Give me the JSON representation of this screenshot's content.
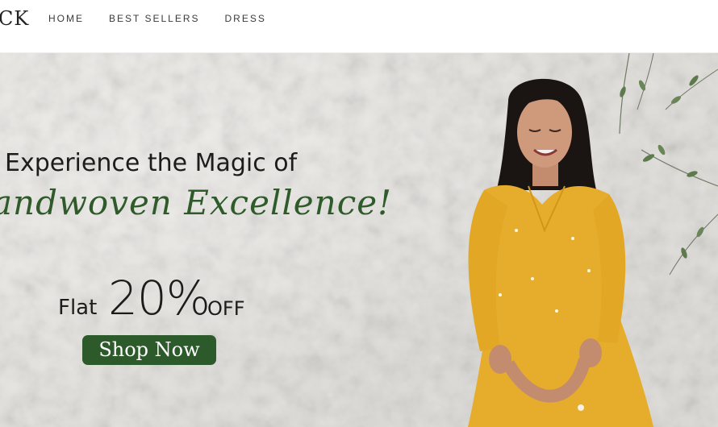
{
  "header": {
    "logo_text": "CK",
    "nav": [
      {
        "label": "HOME"
      },
      {
        "label": "BEST SELLERS"
      },
      {
        "label": "DRESS"
      }
    ]
  },
  "hero": {
    "headline": "Experience the Magic of",
    "script_line": "andwoven Excellence!",
    "offer": {
      "prefix": "Flat",
      "amount": "20%",
      "suffix": "OFF"
    },
    "cta_label": "Shop Now"
  },
  "colors": {
    "brand_green": "#2d5a2a",
    "script_green": "#2f5a2a",
    "dress_yellow": "#e6ad2c",
    "wall": "#e4e2de"
  }
}
